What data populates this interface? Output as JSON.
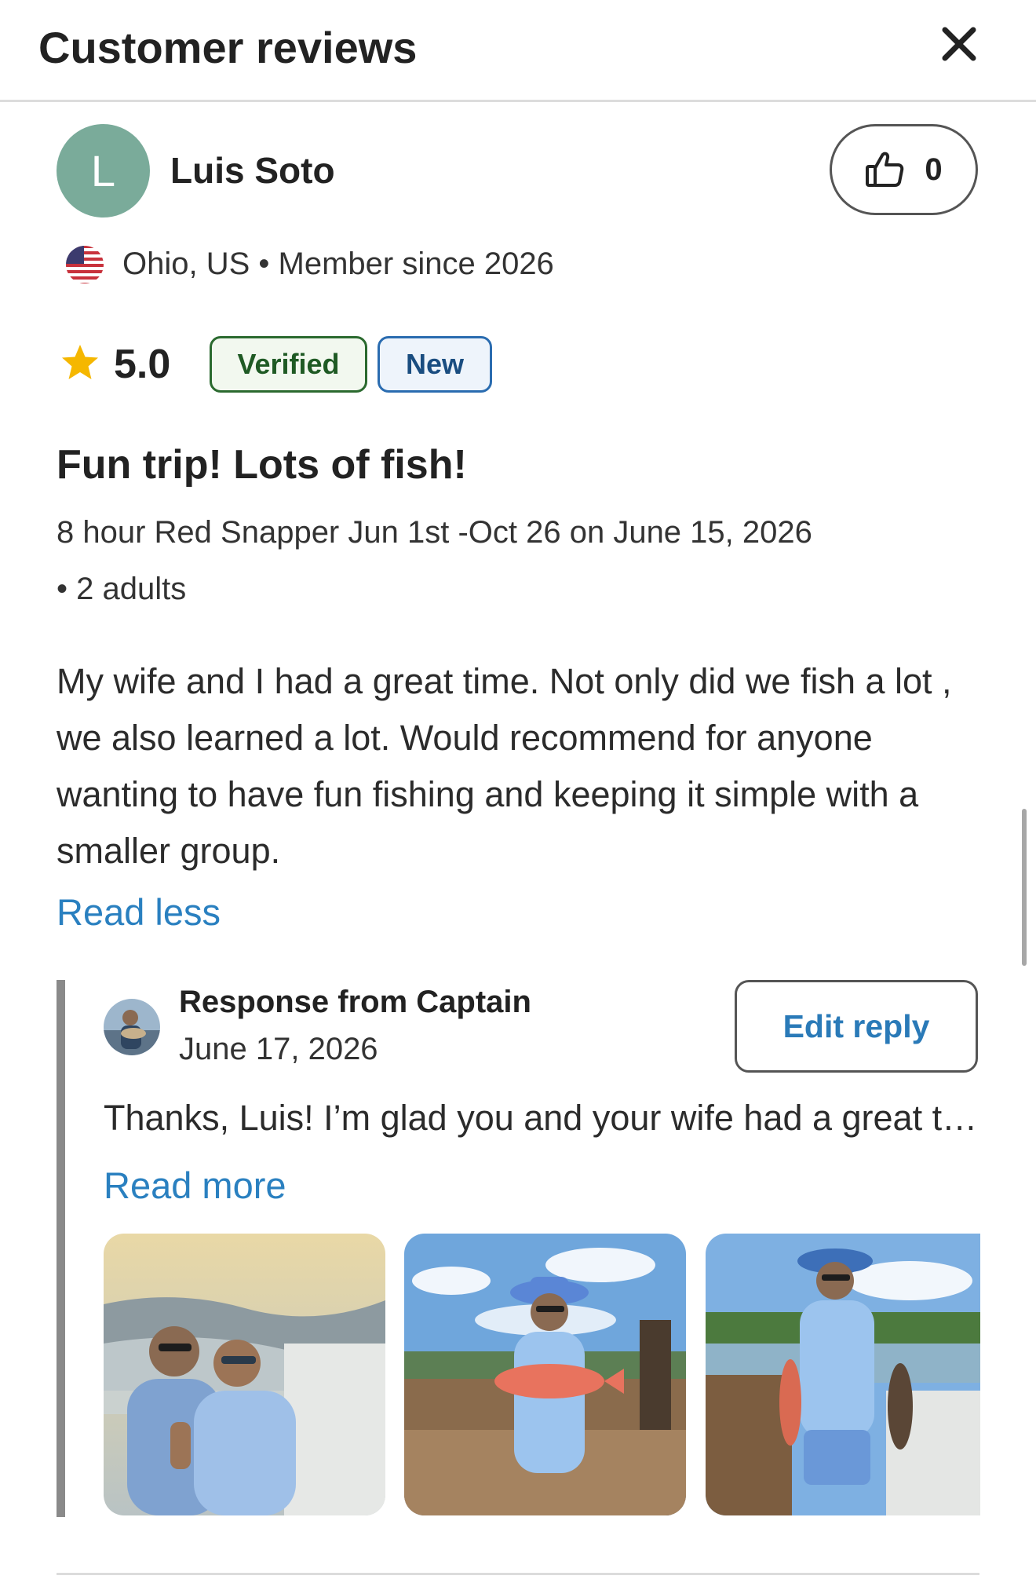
{
  "header": {
    "title": "Customer reviews",
    "close_icon": "close-icon"
  },
  "review": {
    "reviewer": {
      "initial": "L",
      "name": "Luis Soto",
      "avatar_color": "#7aab9a"
    },
    "likes": {
      "icon": "thumbs-up-icon",
      "count": "0"
    },
    "location": {
      "flag_icon": "us-flag-icon",
      "text": "Ohio, US • Member since 2026"
    },
    "rating": {
      "icon": "star-icon",
      "value": "5.0",
      "star_color": "#f5b700"
    },
    "badges": {
      "verified": "Verified",
      "new": "New"
    },
    "title": "Fun trip! Lots of fish!",
    "trip": "8 hour Red Snapper Jun 1st -Oct 26 on June 15, 2026",
    "group": "• 2 adults",
    "body": "My wife and I  had a great time. Not only did we fish a lot , we also learned a lot. Would recommend for anyone wanting to have fun fishing and keeping it simple with a smaller group.",
    "read_less": "Read less"
  },
  "response": {
    "from": "Response from Captain",
    "date": "June 17, 2026",
    "edit_label": "Edit reply",
    "text": "Thanks, Luis! I’m glad you and your wife had a great time",
    "read_more": "Read more"
  },
  "colors": {
    "link": "#2a80c0",
    "verified": "#1f5a24",
    "new": "#1a4d80"
  }
}
